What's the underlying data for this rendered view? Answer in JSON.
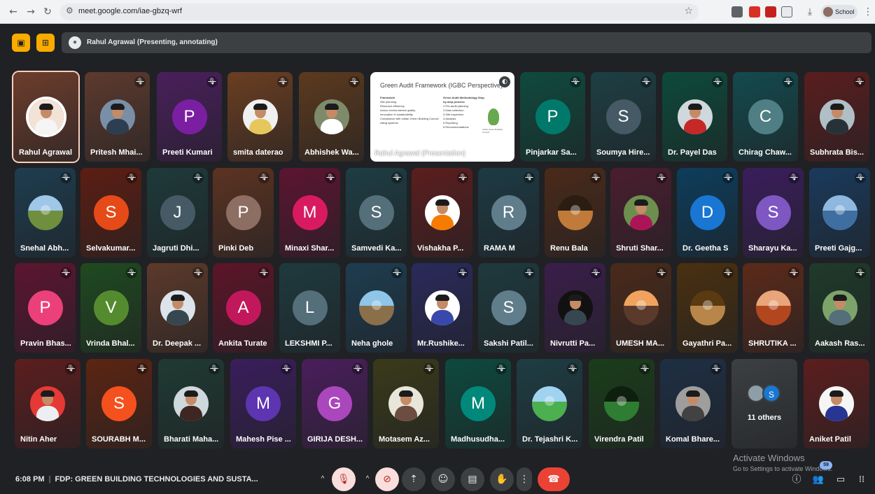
{
  "browser": {
    "url": "meet.google.com/iae-gbzq-wrf",
    "profile_label": "School",
    "icons": [
      "back-icon",
      "forward-icon",
      "reload-icon",
      "tune-icon",
      "star-icon",
      "extension-icons",
      "download-icon",
      "more-vert-icon"
    ]
  },
  "banner": {
    "presenter_text": "Rahul Agrawal (Presenting, annotating)"
  },
  "presentation": {
    "title": "Green Audit Framework (IGBC Perspective)",
    "left_heading": "Framework",
    "left_items": [
      "Site planning",
      "Resource efficiency",
      "Indoor environmental quality",
      "Innovation in sustainability",
      "Compliance with Indian Green Building Council rating systems"
    ],
    "right_heading": "Green Audit Methodology Step-by-step process",
    "right_items": [
      "1.Pre-audit planning",
      "2.Data collection",
      "3.Site inspection",
      "4.Analysis",
      "5.Reporting",
      "6.Recommendations"
    ],
    "logo_caption": "Indian Green Building Council",
    "footer": "Rahul Agrawal (Presentation)"
  },
  "rows": [
    [
      {
        "name": "Rahul Agrawal",
        "type": "photo",
        "color": "#6d3d2c",
        "bg": "#f3e2d6",
        "body": "#f5f5f5",
        "active": true
      },
      {
        "name": "Pritesh Mhai...",
        "type": "photo",
        "color": "#5d3a2e",
        "bg": "#7a8fa6",
        "body": "#2c3e50",
        "muted": true
      },
      {
        "name": "Preeti Kumari",
        "type": "letter",
        "letter": "P",
        "color": "#4a1f5c",
        "avatar": "#7b1fa2",
        "muted": true
      },
      {
        "name": "smita daterao",
        "type": "photo",
        "color": "#6b3e22",
        "bg": "#f0f0f0",
        "body": "#e6c75c",
        "muted": true
      },
      {
        "name": "Abhishek Wa...",
        "type": "photo",
        "color": "#5c3a1e",
        "bg": "#7d8b6a",
        "body": "#ffffff",
        "muted": true
      },
      {
        "name": "Pinjarkar Sa...",
        "type": "letter",
        "letter": "P",
        "color": "#0f4a3e",
        "avatar": "#00796b",
        "muted": true
      },
      {
        "name": "Soumya Hire...",
        "type": "letter",
        "letter": "S",
        "color": "#1d3f44",
        "avatar": "#455a64",
        "muted": true
      },
      {
        "name": "Dr. Payel Das",
        "type": "photo",
        "color": "#0d4a3b",
        "bg": "#cfd8dc",
        "body": "#c62828",
        "muted": true
      },
      {
        "name": "Chirag Chaw...",
        "type": "letter",
        "letter": "C",
        "color": "#134a4e",
        "avatar": "#4f7f84",
        "muted": true
      },
      {
        "name": "Subhrata Bis...",
        "type": "photo",
        "color": "#5a1e1e",
        "bg": "#b0bec5",
        "body": "#263238",
        "muted": true
      }
    ],
    [
      {
        "name": "Snehal Abh...",
        "type": "scene",
        "color": "#1e3d50",
        "sky": "#9ec7e8",
        "land": "#6f8f3f",
        "muted": true
      },
      {
        "name": "Selvakumar...",
        "type": "letter",
        "letter": "S",
        "color": "#5c1e12",
        "avatar": "#e64a19",
        "muted": true
      },
      {
        "name": "Jagruti Dhi...",
        "type": "letter",
        "letter": "J",
        "color": "#1e3a3a",
        "avatar": "#455a64",
        "muted": true
      },
      {
        "name": "Pinki Deb",
        "type": "letter",
        "letter": "P",
        "color": "#5c3322",
        "avatar": "#8d6e63",
        "muted": true
      },
      {
        "name": "Minaxi Shar...",
        "type": "letter",
        "letter": "M",
        "color": "#5c1530",
        "avatar": "#d81b60",
        "muted": true
      },
      {
        "name": "Samvedi Ka...",
        "type": "letter",
        "letter": "S",
        "color": "#1e3d44",
        "avatar": "#546e7a",
        "muted": true
      },
      {
        "name": "Vishakha P...",
        "type": "photo",
        "color": "#5c1e1e",
        "bg": "#ffffff",
        "body": "#f57c00",
        "muted": true
      },
      {
        "name": "RAMA M",
        "type": "letter",
        "letter": "R",
        "color": "#1d3a44",
        "avatar": "#607d8b",
        "muted": true
      },
      {
        "name": "Renu Bala",
        "type": "scene",
        "color": "#4a2a1a",
        "sky": "#2b1d12",
        "land": "#c07a3a",
        "muted": true
      },
      {
        "name": "Shruti Shar...",
        "type": "photo",
        "color": "#4a1e2e",
        "bg": "#6d8f4e",
        "body": "#ad1457",
        "muted": true
      },
      {
        "name": "Dr. Geetha S",
        "type": "letter",
        "letter": "D",
        "color": "#0d3d5c",
        "avatar": "#1976d2",
        "muted": true
      },
      {
        "name": "Sharayu Ka...",
        "type": "letter",
        "letter": "S",
        "color": "#3a1e5c",
        "avatar": "#7e57c2",
        "muted": true
      },
      {
        "name": "Preeti Gajg...",
        "type": "scene",
        "color": "#1a3a5c",
        "sky": "#8fb8de",
        "land": "#3f6fa0",
        "muted": true
      }
    ],
    [
      {
        "name": "Pravin Bhas...",
        "type": "letter",
        "letter": "P",
        "color": "#5c1530",
        "avatar": "#ec407a",
        "muted": true
      },
      {
        "name": "Vrinda Bhal...",
        "type": "letter",
        "letter": "V",
        "color": "#1f4a1f",
        "avatar": "#558b2f",
        "muted": true
      },
      {
        "name": "Dr. Deepak ...",
        "type": "photo",
        "color": "#5c3a2a",
        "bg": "#dde3ea",
        "body": "#37474f",
        "muted": true
      },
      {
        "name": "Ankita Turate",
        "type": "letter",
        "letter": "A",
        "color": "#5c1528",
        "avatar": "#c2185b",
        "muted": true
      },
      {
        "name": "LEKSHMI P...",
        "type": "letter",
        "letter": "L",
        "color": "#1e3a3e",
        "avatar": "#546e7a",
        "muted": false
      },
      {
        "name": "Neha ghole",
        "type": "scene",
        "color": "#1e3d50",
        "sky": "#8ec5e8",
        "land": "#8a6f4a",
        "muted": true
      },
      {
        "name": "Mr.Rushike...",
        "type": "photo",
        "color": "#2a2a5c",
        "bg": "#ffffff",
        "body": "#3949ab",
        "muted": true
      },
      {
        "name": "Sakshi Patil...",
        "type": "letter",
        "letter": "S",
        "color": "#1e3a3e",
        "avatar": "#607d8b",
        "muted": true
      },
      {
        "name": "Nivrutti Pa...",
        "type": "photo",
        "color": "#3a1e4a",
        "bg": "#111111",
        "body": "#37474f",
        "muted": true
      },
      {
        "name": "UMESH MA...",
        "type": "scene",
        "color": "#4a2a1a",
        "sky": "#f0a35e",
        "land": "#5a3a2a",
        "muted": true
      },
      {
        "name": "Gayathri Pa...",
        "type": "scene",
        "color": "#4a3010",
        "sky": "#5a3a10",
        "land": "#b8864a",
        "muted": true
      },
      {
        "name": "SHRUTIKA ...",
        "type": "scene",
        "color": "#5c2a1a",
        "sky": "#e8a57a",
        "land": "#b2471f",
        "muted": true
      },
      {
        "name": "Aakash Ras...",
        "type": "photo",
        "color": "#1f3a2a",
        "bg": "#7da36a",
        "body": "#546e7a",
        "muted": true
      }
    ],
    [
      {
        "name": "Nitin Aher",
        "type": "photo",
        "color": "#5c1e1e",
        "bg": "#e53935",
        "body": "#eceff1",
        "muted": true
      },
      {
        "name": "SOURABH M...",
        "type": "letter",
        "letter": "S",
        "color": "#5c2512",
        "avatar": "#f4511e",
        "muted": true
      },
      {
        "name": "Bharati Maha...",
        "type": "photo",
        "color": "#1f3a33",
        "bg": "#cfd8dc",
        "body": "#3e2723",
        "muted": true
      },
      {
        "name": "Mahesh Pise ...",
        "type": "letter",
        "letter": "M",
        "color": "#3a1e5c",
        "avatar": "#5e35b1",
        "muted": true
      },
      {
        "name": "GIRIJA DESH...",
        "type": "letter",
        "letter": "G",
        "color": "#4a1e5c",
        "avatar": "#ab47bc",
        "muted": true
      },
      {
        "name": "Motasem Az...",
        "type": "photo",
        "color": "#3a3a1a",
        "bg": "#e8e6d9",
        "body": "#6d4c41",
        "muted": true
      },
      {
        "name": "Madhusudha...",
        "type": "letter",
        "letter": "M",
        "color": "#0d4a3e",
        "avatar": "#00897b",
        "muted": true
      },
      {
        "name": "Dr. Tejashri K...",
        "type": "scene",
        "color": "#1e3d44",
        "sky": "#9fd3f0",
        "land": "#4caf50",
        "muted": true
      },
      {
        "name": "Virendra Patil",
        "type": "scene",
        "color": "#1a3d1a",
        "sky": "#0f1f0f",
        "land": "#2e7d32",
        "muted": true
      },
      {
        "name": "Komal Bhare...",
        "type": "photo",
        "color": "#1e2f44",
        "bg": "#9e9e9e",
        "body": "#424242",
        "muted": true
      },
      {
        "name": "11 others",
        "type": "others",
        "color": "#3c4043"
      },
      {
        "name": "Aniket Patil",
        "type": "photo",
        "color": "#5c1e1e",
        "bg": "#f5f5f5",
        "body": "#283593",
        "muted": false
      }
    ]
  ],
  "footer": {
    "time": "6:08 PM",
    "meeting_title": "FDP: GREEN BUILDING TECHNOLOGIES AND SUSTA...",
    "participant_count": "59",
    "colors": {
      "danger": "#ea4335",
      "muted_btn": "#f9dedc",
      "accent": "#f9ab00"
    }
  },
  "watermark": {
    "line1": "Activate Windows",
    "line2": "Go to Settings to activate Windows."
  }
}
